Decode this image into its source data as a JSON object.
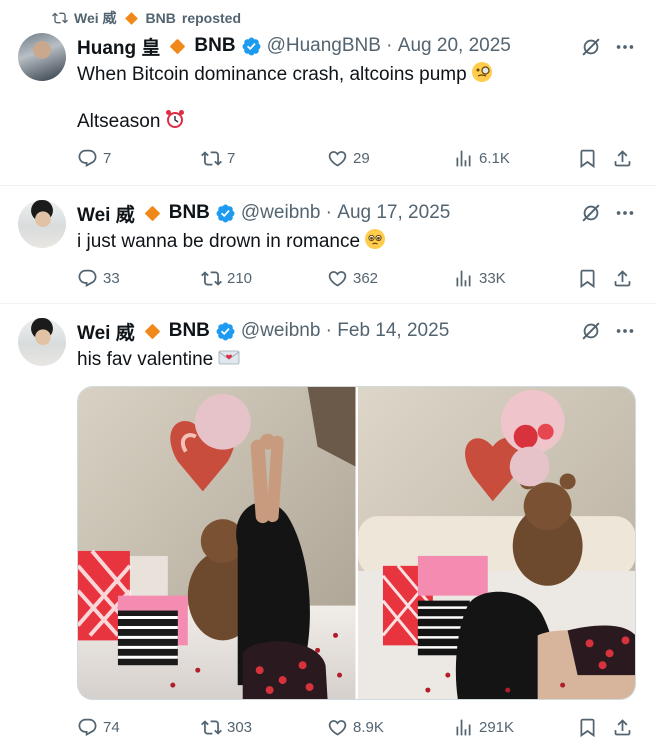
{
  "repost_bar": {
    "by_name": "Wei 威",
    "by_org": "BNB",
    "suffix": "reposted"
  },
  "tweets": [
    {
      "name": "Huang 皇",
      "org": "BNB",
      "handle": "@HuangBNB",
      "date": "Aug 20, 2025",
      "lines": [
        "When Bitcoin dominance crash, altcoins pump",
        "Altseason"
      ],
      "emojis": [
        "monocle-face",
        "alarm-clock"
      ],
      "stats": {
        "replies": "7",
        "reposts": "7",
        "likes": "29",
        "views": "6.1K"
      }
    },
    {
      "name": "Wei 威",
      "org": "BNB",
      "handle": "@weibnb",
      "date": "Aug 17, 2025",
      "lines": [
        "i just wanna be drown in romance"
      ],
      "emojis": [
        "pleading-face"
      ],
      "stats": {
        "replies": "33",
        "reposts": "210",
        "likes": "362",
        "views": "33K"
      }
    },
    {
      "name": "Wei 威",
      "org": "BNB",
      "handle": "@weibnb",
      "date": "Feb 14, 2025",
      "lines": [
        "his fav valentine"
      ],
      "emojis": [
        "love-letter"
      ],
      "stats": {
        "replies": "74",
        "reposts": "303",
        "likes": "8.9K",
        "views": "291K"
      },
      "media": [
        "valentine-photo-1",
        "valentine-photo-2"
      ]
    }
  ],
  "colors": {
    "accent_org": "#f0891a",
    "verified": "#1d9bf0",
    "muted": "#536471",
    "text": "#0f1419",
    "divider": "#eff3f4"
  }
}
